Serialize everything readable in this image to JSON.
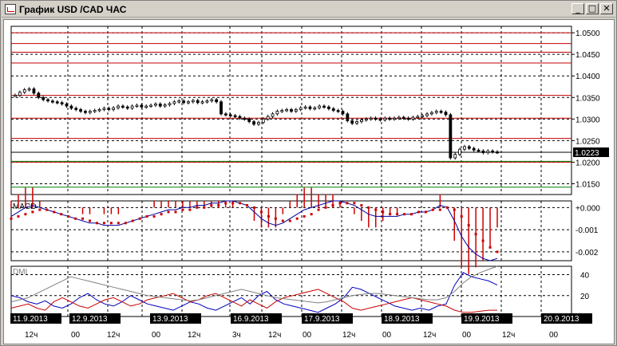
{
  "window": {
    "title": "График USD /CAD  ЧАС",
    "buttons": [
      {
        "name": "minimize-button",
        "glyph": "_"
      },
      {
        "name": "maximize-button",
        "glyph": "□"
      },
      {
        "name": "close-button",
        "glyph": "✕"
      }
    ]
  },
  "price_axis": {
    "labels": [
      "1.0500",
      "1.0450",
      "1.0400",
      "1.0350",
      "1.0300",
      "1.0250",
      "1.0200",
      "1.0150"
    ],
    "current_price": "1.0223"
  },
  "macd_panel": {
    "label": "MACD",
    "axis_labels": [
      "+0.000",
      "-0.001",
      "-0.002"
    ]
  },
  "dmi_panel": {
    "label": "DMI",
    "axis_labels": [
      "40",
      "20"
    ]
  },
  "time_axis": {
    "dates": [
      "11.9.2013",
      "12.9.2013",
      "13.9.2013",
      "16.9.2013",
      "17.9.2013",
      "18.9.2013",
      "19.9.2013",
      "20.9.2013"
    ],
    "hours": [
      "12ч",
      "00",
      "12ч",
      "00",
      "12ч",
      "3ч",
      "12ч",
      "00",
      "12ч",
      "00",
      "12ч",
      "00",
      "12ч",
      "00"
    ]
  },
  "colors": {
    "background": "#ffffff",
    "candles": "#000000",
    "red_levels": "#c00000",
    "green_levels": "#008000",
    "macd_line": "#0000a0",
    "macd_signal": "#cc0000",
    "dmi_plus": "#0000c0",
    "dmi_minus": "#cc0000",
    "adx": "#808080"
  },
  "chart_data": [
    {
      "type": "candlestick",
      "title": "График USD /CAD  ЧАС",
      "xlabel": "",
      "ylabel": "",
      "ylim": [
        1.0125,
        1.0515
      ],
      "x": [
        "11.9.2013",
        "12.9.2013",
        "13.9.2013",
        "16.9.2013",
        "17.9.2013",
        "18.9.2013",
        "19.9.2013",
        "20.9.2013"
      ],
      "close_series": [
        1.0355,
        1.0362,
        1.0368,
        1.037,
        1.036,
        1.035,
        1.0345,
        1.0342,
        1.034,
        1.0338,
        1.0335,
        1.033,
        1.0325,
        1.0322,
        1.0318,
        1.0315,
        1.0318,
        1.032,
        1.0322,
        1.0325,
        1.0322,
        1.0326,
        1.033,
        1.0328,
        1.0325,
        1.033,
        1.0332,
        1.0328,
        1.033,
        1.0332,
        1.0335,
        1.033,
        1.0333,
        1.0336,
        1.034,
        1.0342,
        1.0338,
        1.034,
        1.0343,
        1.0338,
        1.034,
        1.0342,
        1.0345,
        1.034,
        1.0312,
        1.031,
        1.0308,
        1.0306,
        1.0302,
        1.03,
        1.0294,
        1.0288,
        1.0292,
        1.03,
        1.0306,
        1.0312,
        1.0318,
        1.032,
        1.0322,
        1.0318,
        1.0322,
        1.0326,
        1.0328,
        1.0324,
        1.0326,
        1.033,
        1.0328,
        1.0324,
        1.032,
        1.0318,
        1.0312,
        1.0296,
        1.029,
        1.0294,
        1.0298,
        1.03,
        1.0302,
        1.03,
        1.0298,
        1.0302,
        1.03,
        1.0302,
        1.0304,
        1.0302,
        1.03,
        1.0304,
        1.0306,
        1.0308,
        1.0312,
        1.0315,
        1.0318,
        1.0316,
        1.031,
        1.021,
        1.0218,
        1.023,
        1.0236,
        1.0232,
        1.0228,
        1.0226,
        1.0222,
        1.0226,
        1.0224,
        1.0223
      ],
      "support_resistance_red": [
        1.05,
        1.0475,
        1.0455,
        1.043,
        1.0355,
        1.0302,
        1.0255,
        1.02
      ],
      "support_green": [
        1.0202,
        1.0142
      ],
      "current_price": 1.0223
    },
    {
      "type": "line",
      "title": "MACD",
      "ylim": [
        -0.0024,
        0.0003
      ],
      "series": [
        {
          "values": [
            -0.0004,
            -0.0002,
            0.0,
            0.0001,
            0.0,
            -0.0001,
            -0.0002,
            -0.0003,
            -0.0004,
            -0.0005,
            -0.0006,
            -0.0007,
            -0.0007,
            -0.0008,
            -0.0008,
            -0.0008,
            -0.0007,
            -0.0006,
            -0.0005,
            -0.0004,
            -0.0003,
            -0.0002,
            -0.0001,
            -0.0001,
            0.0,
            0.0,
            0.0001,
            0.0001,
            0.0002,
            0.0002,
            0.0003,
            0.0003,
            0.0002,
            0.0001,
            -0.0002,
            -0.0005,
            -0.0007,
            -0.0008,
            -0.0007,
            -0.0005,
            -0.0003,
            -0.0001,
            0.0,
            0.0001,
            0.0002,
            0.0003,
            0.0003,
            0.0002,
            0.0001,
            -0.0001,
            -0.0003,
            -0.0004,
            -0.0004,
            -0.0004,
            -0.0004,
            -0.0003,
            -0.0003,
            -0.0002,
            -0.0002,
            -0.0001,
            0.0001,
            0.0,
            -0.0006,
            -0.0013,
            -0.0018,
            -0.0021,
            -0.0023,
            -0.0024,
            -0.0023
          ]
        },
        {
          "values": [
            -0.0005,
            -0.0004,
            -0.0003,
            -0.0002,
            -0.0001,
            -0.0001,
            -0.0002,
            -0.0003,
            -0.0004,
            -0.0005,
            -0.0005,
            -0.0006,
            -0.0007,
            -0.0007,
            -0.0007,
            -0.0007,
            -0.0007,
            -0.0006,
            -0.0005,
            -0.0004,
            -0.0004,
            -0.0003,
            -0.0002,
            -0.0002,
            -0.0001,
            -0.0001,
            0.0,
            0.0,
            0.0001,
            0.0001,
            0.0002,
            0.0002,
            0.0002,
            0.0001,
            0.0,
            -0.0002,
            -0.0004,
            -0.0005,
            -0.0006,
            -0.0006,
            -0.0005,
            -0.0004,
            -0.0003,
            -0.0001,
            0.0,
            0.0001,
            0.0002,
            0.0002,
            0.0002,
            0.0001,
            0.0,
            -0.0001,
            -0.0002,
            -0.0003,
            -0.0003,
            -0.0003,
            -0.0003,
            -0.0002,
            -0.0002,
            -0.0001,
            -0.0001,
            0.0,
            -0.0001,
            -0.0004,
            -0.0008,
            -0.0012,
            -0.0015,
            -0.0018,
            -0.002
          ]
        }
      ]
    },
    {
      "type": "line",
      "title": "DMI",
      "ylim": [
        0,
        48
      ],
      "series": [
        {
          "values": [
            20,
            18,
            14,
            12,
            15,
            10,
            8,
            12,
            18,
            22,
            16,
            12,
            10,
            14,
            20,
            16,
            12,
            10,
            8,
            6,
            10,
            14,
            12,
            8,
            6,
            10,
            14,
            18,
            12,
            20,
            24,
            16,
            12,
            10,
            8,
            6,
            4,
            8,
            12,
            18,
            28,
            26,
            22,
            18,
            14,
            10,
            8,
            6,
            8,
            6,
            10,
            12,
            30,
            42,
            38,
            36,
            34,
            30
          ]
        },
        {
          "values": [
            8,
            10,
            12,
            8,
            6,
            14,
            18,
            14,
            10,
            8,
            12,
            16,
            18,
            14,
            10,
            12,
            16,
            18,
            20,
            22,
            18,
            14,
            16,
            20,
            22,
            18,
            14,
            10,
            16,
            12,
            8,
            14,
            18,
            20,
            22,
            24,
            26,
            22,
            18,
            14,
            8,
            6,
            8,
            10,
            12,
            14,
            16,
            18,
            16,
            14,
            12,
            10,
            6,
            4,
            4,
            5,
            6,
            6
          ]
        },
        {
          "values": [
            14,
            16,
            18,
            22,
            26,
            30,
            34,
            38,
            36,
            34,
            32,
            30,
            28,
            26,
            24,
            22,
            20,
            19,
            18,
            17,
            16,
            15,
            16,
            18,
            20,
            22,
            24,
            26,
            24,
            22,
            20,
            18,
            17,
            16,
            15,
            14,
            13,
            14,
            16,
            18,
            20,
            21,
            22,
            22,
            21,
            20,
            19,
            18,
            17,
            16,
            16,
            18,
            24,
            32,
            38,
            42,
            45,
            48
          ]
        }
      ]
    }
  ]
}
